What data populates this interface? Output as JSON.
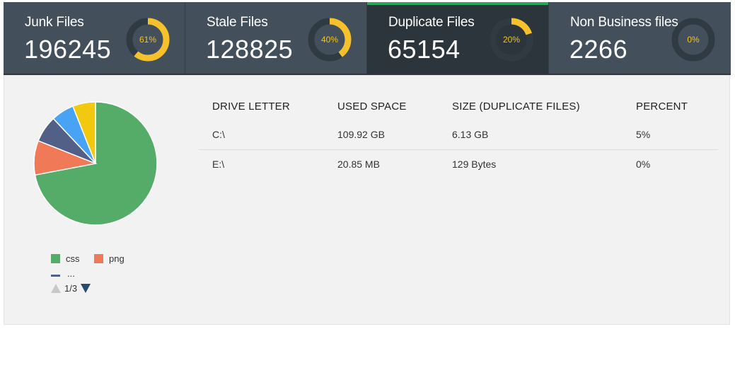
{
  "cards": [
    {
      "title": "Junk Files",
      "count": "196245",
      "percent_label": "61%",
      "percent": 61
    },
    {
      "title": "Stale Files",
      "count": "128825",
      "percent_label": "40%",
      "percent": 40
    },
    {
      "title": "Duplicate Files",
      "count": "65154",
      "percent_label": "20%",
      "percent": 20
    },
    {
      "title": "Non Business files",
      "count": "2266",
      "percent_label": "0%",
      "percent": 0
    }
  ],
  "colors": {
    "ring_fill": "#f6c12a",
    "ring_track": "#303a43",
    "active_accent": "#27a85d",
    "card_bg": "#434f5a",
    "card_active_bg": "#2d353c"
  },
  "chart_data": {
    "type": "pie",
    "slices": [
      {
        "name": "css",
        "value": 72,
        "color": "#55ab68"
      },
      {
        "name": "png",
        "value": 9,
        "color": "#f07a58"
      },
      {
        "name": "",
        "value": 7,
        "color": "#525f87"
      },
      {
        "name": "",
        "value": 6,
        "color": "#49a3f5"
      },
      {
        "name": "",
        "value": 6,
        "color": "#f2c90e"
      }
    ],
    "legend": {
      "items": [
        {
          "label": "css",
          "color": "#55ab68"
        },
        {
          "label": "png",
          "color": "#f07a58"
        },
        {
          "label": "...",
          "color": "#525f87"
        }
      ],
      "page": "1/3"
    }
  },
  "table": {
    "headers": [
      "DRIVE LETTER",
      "USED SPACE",
      "SIZE (DUPLICATE FILES)",
      "PERCENT"
    ],
    "rows": [
      [
        "C:\\",
        "109.92 GB",
        "6.13 GB",
        "5%"
      ],
      [
        "E:\\",
        "20.85 MB",
        "129 Bytes",
        "0%"
      ]
    ]
  }
}
